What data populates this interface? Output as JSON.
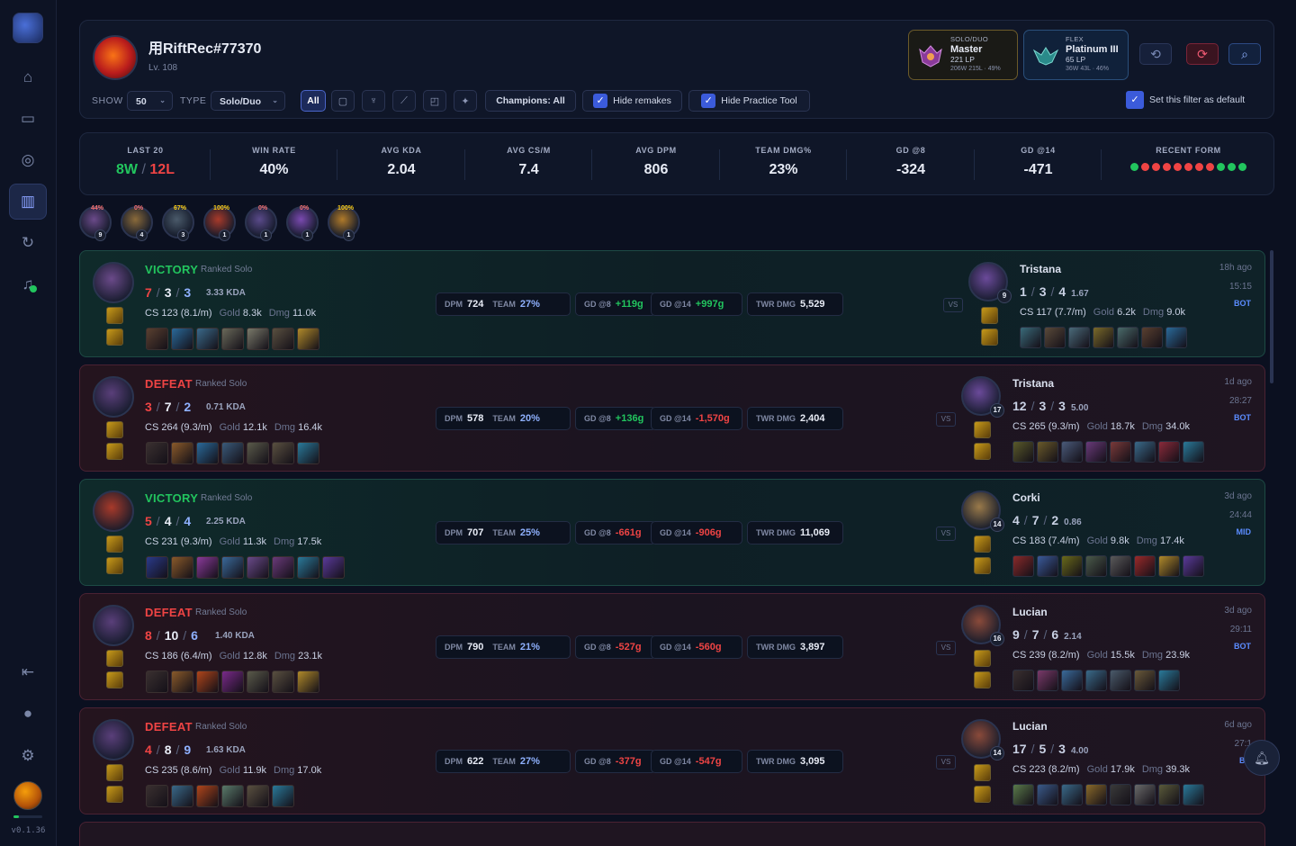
{
  "sidebar": {
    "items": [
      "home",
      "recordings",
      "circle",
      "stats",
      "history",
      "notifications"
    ],
    "version": "v0.1.36"
  },
  "profile": {
    "name": "用RiftRec#77370",
    "level": "Lv. 108"
  },
  "ranks": [
    {
      "queue": "SOLO/DUO",
      "tier": "Master",
      "lp": "221 LP",
      "wl": "206W 215L · 49%"
    },
    {
      "queue": "FLEX",
      "tier": "Platinum III",
      "lp": "65 LP",
      "wl": "36W 43L · 46%"
    }
  ],
  "filters": {
    "show_label": "SHOW",
    "show_value": "50",
    "type_label": "TYPE",
    "type_value": "Solo/Duo",
    "all": "All",
    "champions": "Champions: All",
    "hide_remakes": "Hide remakes",
    "hide_practice": "Hide Practice Tool",
    "set_default": "Set this filter as default"
  },
  "stats": [
    {
      "label": "LAST 20",
      "value_w": "8W",
      "value_l": "12L"
    },
    {
      "label": "WIN RATE",
      "value": "40%"
    },
    {
      "label": "AVG KDA",
      "value": "2.04"
    },
    {
      "label": "AVG CS/M",
      "value": "7.4"
    },
    {
      "label": "AVG DPM",
      "value": "806"
    },
    {
      "label": "TEAM DMG%",
      "value": "23%"
    },
    {
      "label": "GD @8",
      "value": "-324"
    },
    {
      "label": "GD @14",
      "value": "-471"
    },
    {
      "label": "RECENT FORM",
      "form": [
        "g",
        "r",
        "r",
        "r",
        "r",
        "r",
        "r",
        "r",
        "g",
        "g",
        "g"
      ]
    }
  ],
  "champ_strip": [
    {
      "pct": "44%",
      "count": "9",
      "color": "#6b4a8a"
    },
    {
      "pct": "0%",
      "count": "4",
      "color": "#8a6a3a"
    },
    {
      "pct": "67%",
      "count": "3",
      "color": "#4a5a6a"
    },
    {
      "pct": "100%",
      "count": "1",
      "color": "#a83a2a"
    },
    {
      "pct": "0%",
      "count": "1",
      "color": "#5a4a8a"
    },
    {
      "pct": "0%",
      "count": "1",
      "color": "#7a4ab0"
    },
    {
      "pct": "100%",
      "count": "1",
      "color": "#b07a2a"
    }
  ],
  "matches": [
    {
      "result": "VICTORY",
      "queue": "Ranked Solo",
      "k": "7",
      "d": "3",
      "a": "3",
      "kda": "3.33 KDA",
      "cs": "CS 123 (8.1/m)",
      "gold_k": "Gold",
      "gold": "8.3k",
      "dmg_k": "Dmg",
      "dmg": "11.0k",
      "dpm": "724",
      "team": "27%",
      "gd8": "+119g",
      "gd14": "+997g",
      "twr": "5,529",
      "opp": "Tristana",
      "opp_lvl": "9",
      "ok": "1",
      "od": "3",
      "oa": "4",
      "okda": "1.67",
      "ocs": "CS 117 (7.7/m)",
      "ogold": "6.2k",
      "odmg": "9.0k",
      "ago": "18h ago",
      "dur": "15:15",
      "role": "BOT"
    },
    {
      "result": "DEFEAT",
      "queue": "Ranked Solo",
      "k": "3",
      "d": "7",
      "a": "2",
      "kda": "0.71 KDA",
      "cs": "CS 264 (9.3/m)",
      "gold_k": "Gold",
      "gold": "12.1k",
      "dmg_k": "Dmg",
      "dmg": "16.4k",
      "dpm": "578",
      "team": "20%",
      "gd8": "+136g",
      "gd14": "-1,570g",
      "twr": "2,404",
      "opp": "Tristana",
      "opp_lvl": "17",
      "ok": "12",
      "od": "3",
      "oa": "3",
      "okda": "5.00",
      "ocs": "CS 265 (9.3/m)",
      "ogold": "18.7k",
      "odmg": "34.0k",
      "ago": "1d ago",
      "dur": "28:27",
      "role": "BOT"
    },
    {
      "result": "VICTORY",
      "queue": "Ranked Solo",
      "k": "5",
      "d": "4",
      "a": "4",
      "kda": "2.25 KDA",
      "cs": "CS 231 (9.3/m)",
      "gold_k": "Gold",
      "gold": "11.3k",
      "dmg_k": "Dmg",
      "dmg": "17.5k",
      "dpm": "707",
      "team": "25%",
      "gd8": "-661g",
      "gd14": "-906g",
      "twr": "11,069",
      "opp": "Corki",
      "opp_lvl": "14",
      "ok": "4",
      "od": "7",
      "oa": "2",
      "okda": "0.86",
      "ocs": "CS 183 (7.4/m)",
      "ogold": "9.8k",
      "odmg": "17.4k",
      "ago": "3d ago",
      "dur": "24:44",
      "role": "MID"
    },
    {
      "result": "DEFEAT",
      "queue": "Ranked Solo",
      "k": "8",
      "d": "10",
      "a": "6",
      "kda": "1.40 KDA",
      "cs": "CS 186 (6.4/m)",
      "gold_k": "Gold",
      "gold": "12.8k",
      "dmg_k": "Dmg",
      "dmg": "23.1k",
      "dpm": "790",
      "team": "21%",
      "gd8": "-527g",
      "gd14": "-560g",
      "twr": "3,897",
      "opp": "Lucian",
      "opp_lvl": "16",
      "ok": "9",
      "od": "7",
      "oa": "6",
      "okda": "2.14",
      "ocs": "CS 239 (8.2/m)",
      "ogold": "15.5k",
      "odmg": "23.9k",
      "ago": "3d ago",
      "dur": "29:11",
      "role": "BOT"
    },
    {
      "result": "DEFEAT",
      "queue": "Ranked Solo",
      "k": "4",
      "d": "8",
      "a": "9",
      "kda": "1.63 KDA",
      "cs": "CS 235 (8.6/m)",
      "gold_k": "Gold",
      "gold": "11.9k",
      "dmg_k": "Dmg",
      "dmg": "17.0k",
      "dpm": "622",
      "team": "27%",
      "gd8": "-377g",
      "gd14": "-547g",
      "twr": "3,095",
      "opp": "Lucian",
      "opp_lvl": "14",
      "ok": "17",
      "od": "5",
      "oa": "3",
      "okda": "4.00",
      "ocs": "CS 223 (8.2/m)",
      "ogold": "17.9k",
      "odmg": "39.3k",
      "ago": "6d ago",
      "dur": "27:1",
      "role": "BC"
    }
  ],
  "labels": {
    "dpm": "DPM",
    "team": "TEAM",
    "gd8": "GD @8",
    "gd14": "GD @14",
    "twr": "TWR DMG",
    "vs": "VS"
  },
  "colors": {
    "win": "#22c55e",
    "loss": "#ef4444",
    "accent": "#3b5bdb"
  }
}
